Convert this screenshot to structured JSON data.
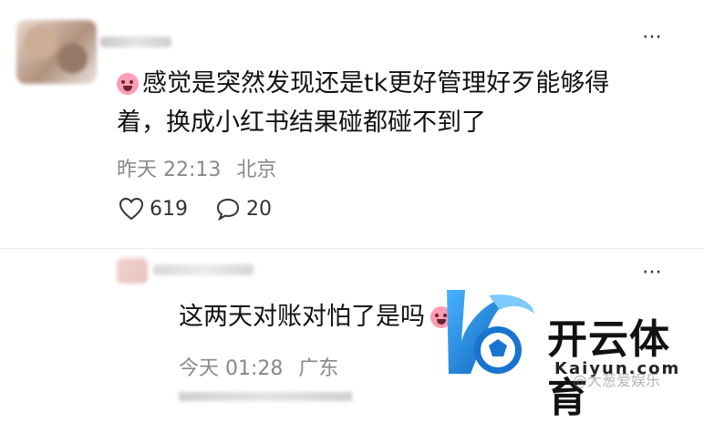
{
  "comment": {
    "text": "感觉是突然发现还是tk更好管理好歹能够得着，换成小红书结果碰都碰不到了",
    "date": "昨天 22:13",
    "location": "北京",
    "likes": "619",
    "replies": "20",
    "more": "⋯"
  },
  "reply": {
    "text": "这两天对账对怕了是吗",
    "date": "今天 01:28",
    "location": "广东",
    "more": "⋯"
  },
  "brand": {
    "name_cn": "开云体育",
    "name_en": "Kaiyun.com",
    "watermark": "@大葱爱娱乐",
    "accent": "#1a73c9"
  },
  "icons": {
    "emoji": "crying-face-icon",
    "like": "heart-outline-icon",
    "reply": "speech-bubble-icon",
    "more": "ellipsis-icon"
  }
}
